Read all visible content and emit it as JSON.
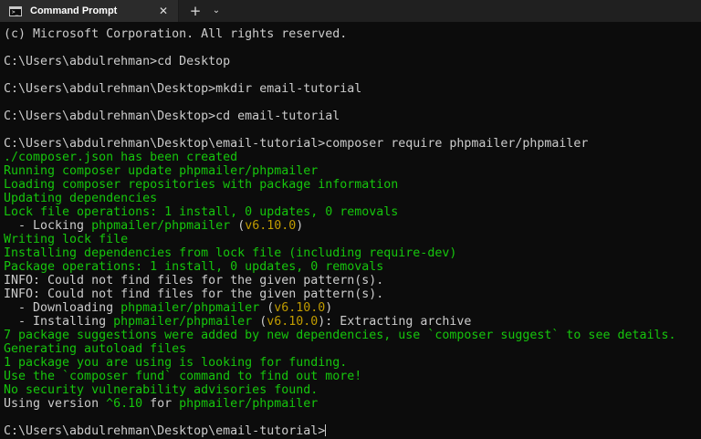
{
  "window": {
    "tab_title": "Command Prompt",
    "close_glyph": "✕",
    "new_tab_glyph": "+",
    "dropdown_glyph": "⌄",
    "icon_glyph": ">_"
  },
  "colors": {
    "background": "#0c0c0c",
    "default_text": "#cccccc",
    "green": "#16c60c",
    "yellow": "#c19c00",
    "titlebar": "#202020",
    "tab": "#2b2b2b"
  },
  "terminal": {
    "lines": [
      [
        {
          "t": "(c) Microsoft Corporation. All rights reserved.",
          "c": "w"
        }
      ],
      [],
      [
        {
          "t": "C:\\Users\\abdulrehman>cd Desktop",
          "c": "w"
        }
      ],
      [],
      [
        {
          "t": "C:\\Users\\abdulrehman\\Desktop>mkdir email-tutorial",
          "c": "w"
        }
      ],
      [],
      [
        {
          "t": "C:\\Users\\abdulrehman\\Desktop>cd email-tutorial",
          "c": "w"
        }
      ],
      [],
      [
        {
          "t": "C:\\Users\\abdulrehman\\Desktop\\email-tutorial>composer require phpmailer/phpmailer",
          "c": "w"
        }
      ],
      [
        {
          "t": "./composer.json has been created",
          "c": "g"
        }
      ],
      [
        {
          "t": "Running composer update phpmailer/phpmailer",
          "c": "g"
        }
      ],
      [
        {
          "t": "Loading composer repositories with package information",
          "c": "g"
        }
      ],
      [
        {
          "t": "Updating dependencies",
          "c": "g"
        }
      ],
      [
        {
          "t": "Lock file operations: 1 install, 0 updates, 0 removals",
          "c": "g"
        }
      ],
      [
        {
          "t": "  - Locking ",
          "c": "w"
        },
        {
          "t": "phpmailer/phpmailer",
          "c": "g"
        },
        {
          "t": " (",
          "c": "w"
        },
        {
          "t": "v6.10.0",
          "c": "y"
        },
        {
          "t": ")",
          "c": "w"
        }
      ],
      [
        {
          "t": "Writing lock file",
          "c": "g"
        }
      ],
      [
        {
          "t": "Installing dependencies from lock file (including require-dev)",
          "c": "g"
        }
      ],
      [
        {
          "t": "Package operations: 1 install, 0 updates, 0 removals",
          "c": "g"
        }
      ],
      [
        {
          "t": "INFO: Could not find files for the given pattern(s).",
          "c": "w"
        }
      ],
      [
        {
          "t": "INFO: Could not find files for the given pattern(s).",
          "c": "w"
        }
      ],
      [
        {
          "t": "  - Downloading ",
          "c": "w"
        },
        {
          "t": "phpmailer/phpmailer",
          "c": "g"
        },
        {
          "t": " (",
          "c": "w"
        },
        {
          "t": "v6.10.0",
          "c": "y"
        },
        {
          "t": ")",
          "c": "w"
        }
      ],
      [
        {
          "t": "  - Installing ",
          "c": "w"
        },
        {
          "t": "phpmailer/phpmailer",
          "c": "g"
        },
        {
          "t": " (",
          "c": "w"
        },
        {
          "t": "v6.10.0",
          "c": "y"
        },
        {
          "t": "): Extracting archive",
          "c": "w"
        }
      ],
      [
        {
          "t": "7 package suggestions were added by new dependencies, use `composer suggest` to see details.",
          "c": "g"
        }
      ],
      [
        {
          "t": "Generating autoload files",
          "c": "g"
        }
      ],
      [
        {
          "t": "1 package you are using is looking for funding.",
          "c": "g"
        }
      ],
      [
        {
          "t": "Use the `composer fund` command to find out more!",
          "c": "g"
        }
      ],
      [
        {
          "t": "No security vulnerability advisories found.",
          "c": "g"
        }
      ],
      [
        {
          "t": "Using version ",
          "c": "w"
        },
        {
          "t": "^6.10",
          "c": "g"
        },
        {
          "t": " for ",
          "c": "w"
        },
        {
          "t": "phpmailer/phpmailer",
          "c": "g"
        }
      ],
      [],
      [
        {
          "t": "C:\\Users\\abdulrehman\\Desktop\\email-tutorial>",
          "c": "w"
        }
      ]
    ]
  }
}
